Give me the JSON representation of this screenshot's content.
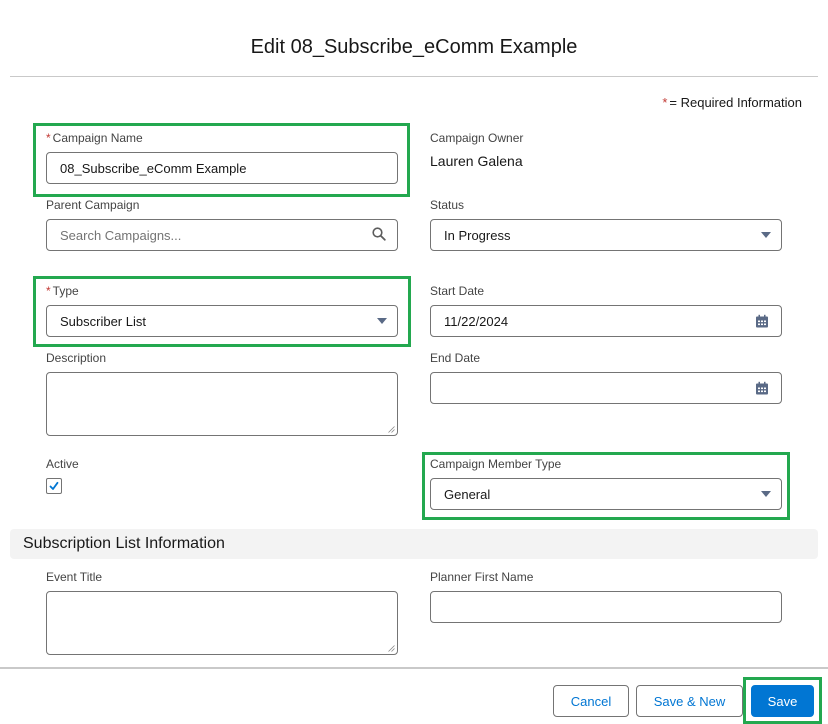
{
  "modal": {
    "title": "Edit 08_Subscribe_eComm Example",
    "required_marker": "*",
    "required_info": "= Required Information"
  },
  "fields": {
    "campaign_name": {
      "label": "Campaign Name",
      "required": true,
      "value": "08_Subscribe_eComm Example"
    },
    "campaign_owner": {
      "label": "Campaign Owner",
      "value": "Lauren Galena"
    },
    "parent_campaign": {
      "label": "Parent Campaign",
      "placeholder": "Search Campaigns...",
      "value": ""
    },
    "status": {
      "label": "Status",
      "value": "In Progress"
    },
    "type": {
      "label": "Type",
      "required": true,
      "value": "Subscriber List"
    },
    "start_date": {
      "label": "Start Date",
      "value": "11/22/2024"
    },
    "description": {
      "label": "Description",
      "value": ""
    },
    "end_date": {
      "label": "End Date",
      "value": ""
    },
    "active": {
      "label": "Active",
      "checked": true
    },
    "campaign_member_type": {
      "label": "Campaign Member Type",
      "value": "General"
    }
  },
  "section": {
    "title": "Subscription List Information",
    "fields": {
      "event_title": {
        "label": "Event Title",
        "value": ""
      },
      "planner_first_name": {
        "label": "Planner First Name",
        "value": ""
      }
    }
  },
  "footer": {
    "cancel_label": "Cancel",
    "save_new_label": "Save & New",
    "save_label": "Save"
  },
  "colors": {
    "brand": "#0176d3",
    "required": "#c23934",
    "highlight": "#23a84f"
  },
  "icons": {
    "search": "search-icon",
    "calendar": "calendar-icon",
    "dropdown": "chevron-down-icon",
    "checkmark": "checkmark-icon"
  }
}
